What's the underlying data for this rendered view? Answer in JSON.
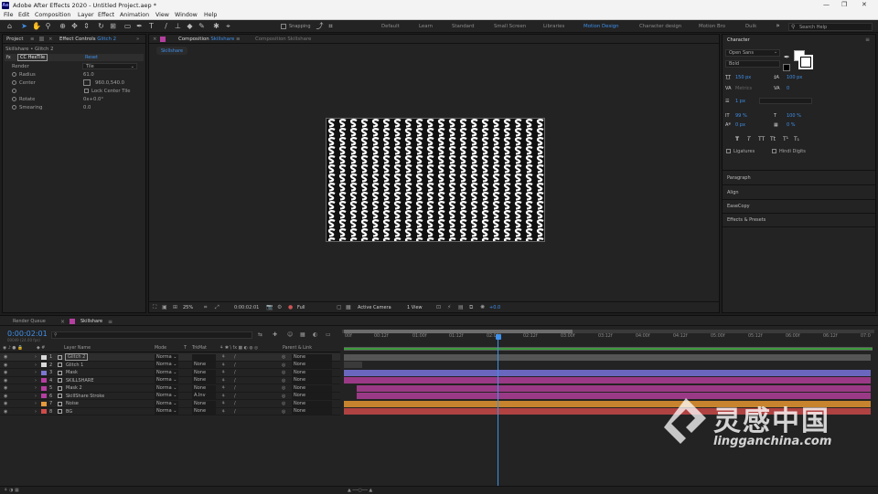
{
  "window": {
    "title": "Adobe After Effects 2020 - Untitled Project.aep *",
    "logo": "Ae"
  },
  "menu": [
    "File",
    "Edit",
    "Composition",
    "Layer",
    "Effect",
    "Animation",
    "View",
    "Window",
    "Help"
  ],
  "toolbar": {
    "snapping": "Snapping"
  },
  "workspaces": [
    "Default",
    "Learn",
    "Standard",
    "Small Screen",
    "Libraries",
    "Motion Design",
    "Character design",
    "Motion Bro",
    "Duik"
  ],
  "active_workspace": "Motion Design",
  "search_help": "Search Help",
  "project_panel": {
    "tab_project": "Project",
    "tab_effect_controls": "Effect Controls",
    "layer_name": "Glitch 2",
    "breadcrumb": "Skillshare • Glitch 2",
    "effect_name": "CC HexTile",
    "reset": "Reset",
    "props": [
      {
        "label": "Render",
        "value": "Tile"
      },
      {
        "label": "Radius",
        "value": "61.0"
      },
      {
        "label": "Center",
        "value": "960.0,540.0"
      },
      {
        "label": "",
        "value": "Lock Center Tile"
      },
      {
        "label": "Rotate",
        "value": "0x+0.0°"
      },
      {
        "label": "Smearing",
        "value": "0.0"
      }
    ]
  },
  "composition": {
    "tab": "Composition",
    "comp_name": "Skillshare",
    "tab2": "Composition Skillshare",
    "breadcrumb": "Skillshare",
    "zoom": "25%",
    "timecode": "0:00:02:01",
    "resolution": "Full",
    "camera": "Active Camera",
    "views": "1 View",
    "exposure": "+0.0"
  },
  "character": {
    "title": "Character",
    "font": "Open Sans",
    "style": "Bold",
    "font_size": "150 px",
    "leading": "100 px",
    "tracking_label": "Metrics",
    "tracking": "0",
    "stroke": "1 px",
    "vscale": "99 %",
    "hscale": "100 %",
    "baseline": "0 px",
    "tsume": "0 %",
    "styles": [
      "T",
      "T",
      "TT",
      "Tt",
      "T¹",
      "T₁"
    ],
    "ligatures": "Ligatures",
    "hindi": "Hindi Digits",
    "sections": [
      "Paragraph",
      "Align",
      "EaseCopy",
      "Effects & Presets"
    ]
  },
  "timeline": {
    "tab_render": "Render Queue",
    "tab_comp": "Skillshare",
    "timecode": "0:00:02:01",
    "fps": "00049 (24.00 fps)",
    "columns": {
      "name": "Layer Name",
      "mode": "Mode",
      "trkmat": "TrkMat",
      "parent": "Parent & Link"
    },
    "ruler": [
      "00f",
      "00:12f",
      "01:00f",
      "01:12f",
      "02:00f",
      "02:12f",
      "03:00f",
      "03:12f",
      "04:00f",
      "04:12f",
      "05:00f",
      "05:12f",
      "06:00f",
      "06:12f",
      "07:0"
    ],
    "layers": [
      {
        "num": "1",
        "name": "Glitch 2",
        "color": "#d9d9d9",
        "mode": "Norma",
        "trk": "",
        "parent": "None",
        "bar": "#555"
      },
      {
        "num": "2",
        "name": "Glitch 1",
        "color": "#d9d9d9",
        "mode": "Norma",
        "trk": "None",
        "parent": "None",
        "bar": "#3a3a3a"
      },
      {
        "num": "3",
        "name": "Mask",
        "color": "#7b77d1",
        "mode": "Norma",
        "trk": "None",
        "parent": "None",
        "bar": "#6a67be"
      },
      {
        "num": "4",
        "name": "SKILLSHARE",
        "color": "#b53fa0",
        "mode": "Norma",
        "trk": "None",
        "parent": "None",
        "bar": "#9a3a86"
      },
      {
        "num": "5",
        "name": "Mask 2",
        "color": "#b53fa0",
        "mode": "Norma",
        "trk": "None",
        "parent": "None",
        "bar": "#9a3a86"
      },
      {
        "num": "6",
        "name": "SkillShare Stroke",
        "color": "#b53fa0",
        "mode": "Norma",
        "trk": "A.Inv",
        "parent": "None",
        "bar": "#9a3a86"
      },
      {
        "num": "7",
        "name": "Noise",
        "color": "#e59a3c",
        "mode": "Norma",
        "trk": "None",
        "parent": "None",
        "bar": "#c7832e"
      },
      {
        "num": "8",
        "name": "BG",
        "color": "#d14a4a",
        "mode": "Norma",
        "trk": "None",
        "parent": "None",
        "bar": "#b04242"
      }
    ]
  },
  "watermark": {
    "brand": "灵感中国",
    "url": "lingganchina.com"
  }
}
